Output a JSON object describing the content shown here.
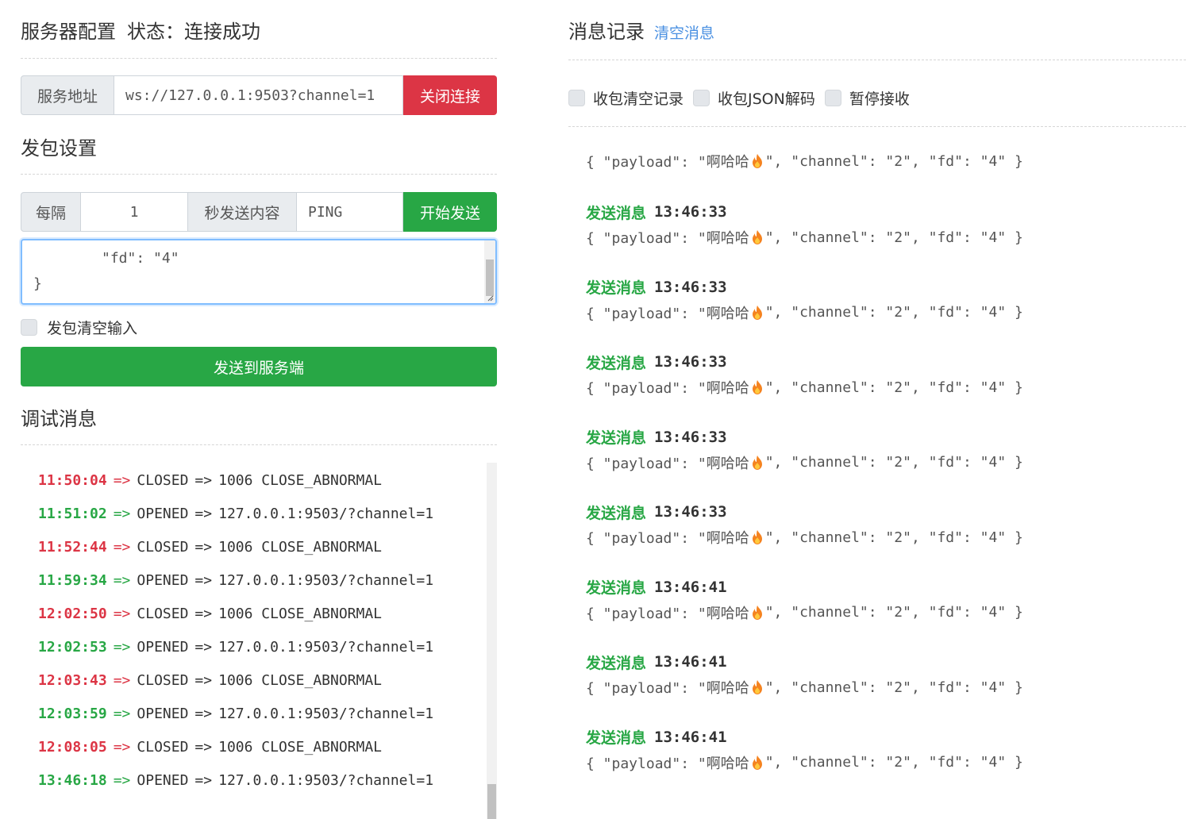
{
  "server": {
    "title": "服务器配置",
    "status_label": "状态：",
    "status_value": "连接成功",
    "address_label": "服务地址",
    "address_value": "ws://127.0.0.1:9503?channel=1",
    "close_button": "关闭连接"
  },
  "send": {
    "title": "发包设置",
    "every_label": "每隔",
    "interval_value": "1",
    "sec_label": "秒发送内容",
    "content_value": "PING",
    "start_button": "开始发送",
    "textarea_line1": "\"fd\": \"4\"",
    "textarea_line2": "}",
    "clear_input_label": "发包清空输入",
    "send_button": "发送到服务端"
  },
  "debug": {
    "title": "调试消息",
    "logs": [
      {
        "time": "11:50:04",
        "arrow": "=>",
        "state": "CLOSED",
        "arrow2": "=>",
        "detail": "1006 CLOSE_ABNORMAL",
        "status": "closed"
      },
      {
        "time": "11:51:02",
        "arrow": "=>",
        "state": "OPENED",
        "arrow2": "=>",
        "detail": "127.0.0.1:9503/?channel=1",
        "status": "opened"
      },
      {
        "time": "11:52:44",
        "arrow": "=>",
        "state": "CLOSED",
        "arrow2": "=>",
        "detail": "1006 CLOSE_ABNORMAL",
        "status": "closed"
      },
      {
        "time": "11:59:34",
        "arrow": "=>",
        "state": "OPENED",
        "arrow2": "=>",
        "detail": "127.0.0.1:9503/?channel=1",
        "status": "opened"
      },
      {
        "time": "12:02:50",
        "arrow": "=>",
        "state": "CLOSED",
        "arrow2": "=>",
        "detail": "1006 CLOSE_ABNORMAL",
        "status": "closed"
      },
      {
        "time": "12:02:53",
        "arrow": "=>",
        "state": "OPENED",
        "arrow2": "=>",
        "detail": "127.0.0.1:9503/?channel=1",
        "status": "opened"
      },
      {
        "time": "12:03:43",
        "arrow": "=>",
        "state": "CLOSED",
        "arrow2": "=>",
        "detail": "1006 CLOSE_ABNORMAL",
        "status": "closed"
      },
      {
        "time": "12:03:59",
        "arrow": "=>",
        "state": "OPENED",
        "arrow2": "=>",
        "detail": "127.0.0.1:9503/?channel=1",
        "status": "opened"
      },
      {
        "time": "12:08:05",
        "arrow": "=>",
        "state": "CLOSED",
        "arrow2": "=>",
        "detail": "1006 CLOSE_ABNORMAL",
        "status": "closed"
      },
      {
        "time": "13:46:18",
        "arrow": "=>",
        "state": "OPENED",
        "arrow2": "=>",
        "detail": "127.0.0.1:9503/?channel=1",
        "status": "opened"
      }
    ]
  },
  "messages": {
    "title": "消息记录",
    "clear_link": "清空消息",
    "options": [
      "收包清空记录",
      "收包JSON解码",
      "暂停接收"
    ],
    "first_body_pre": "{ \"payload\": \"啊哈哈",
    "first_body_post": "\", \"channel\": \"2\", \"fd\": \"4\" }",
    "items": [
      {
        "label": "发送消息",
        "time": "13:46:33",
        "body_pre": "{ \"payload\": \"啊哈哈",
        "body_post": "\", \"channel\": \"2\", \"fd\": \"4\" }"
      },
      {
        "label": "发送消息",
        "time": "13:46:33",
        "body_pre": "{ \"payload\": \"啊哈哈",
        "body_post": "\", \"channel\": \"2\", \"fd\": \"4\" }"
      },
      {
        "label": "发送消息",
        "time": "13:46:33",
        "body_pre": "{ \"payload\": \"啊哈哈",
        "body_post": "\", \"channel\": \"2\", \"fd\": \"4\" }"
      },
      {
        "label": "发送消息",
        "time": "13:46:33",
        "body_pre": "{ \"payload\": \"啊哈哈",
        "body_post": "\", \"channel\": \"2\", \"fd\": \"4\" }"
      },
      {
        "label": "发送消息",
        "time": "13:46:33",
        "body_pre": "{ \"payload\": \"啊哈哈",
        "body_post": "\", \"channel\": \"2\", \"fd\": \"4\" }"
      },
      {
        "label": "发送消息",
        "time": "13:46:41",
        "body_pre": "{ \"payload\": \"啊哈哈",
        "body_post": "\", \"channel\": \"2\", \"fd\": \"4\" }"
      },
      {
        "label": "发送消息",
        "time": "13:46:41",
        "body_pre": "{ \"payload\": \"啊哈哈",
        "body_post": "\", \"channel\": \"2\", \"fd\": \"4\" }"
      },
      {
        "label": "发送消息",
        "time": "13:46:41",
        "body_pre": "{ \"payload\": \"啊哈哈",
        "body_post": "\", \"channel\": \"2\", \"fd\": \"4\" }"
      }
    ]
  },
  "colors": {
    "green": "#28a745",
    "red": "#dc3545",
    "link": "#4a90e2"
  }
}
